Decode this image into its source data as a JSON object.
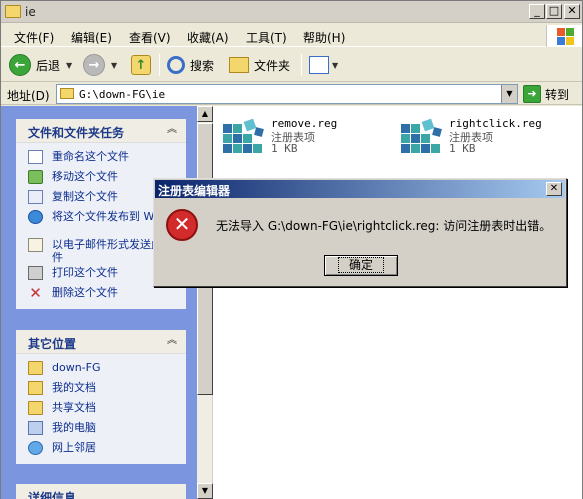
{
  "window": {
    "title": "ie"
  },
  "menu": [
    {
      "label": "文件(F)"
    },
    {
      "label": "编辑(E)"
    },
    {
      "label": "查看(V)"
    },
    {
      "label": "收藏(A)"
    },
    {
      "label": "工具(T)"
    },
    {
      "label": "帮助(H)"
    }
  ],
  "toolbar": {
    "back_label": "后退",
    "search_label": "搜索",
    "folders_label": "文件夹"
  },
  "address": {
    "label": "地址(D)",
    "value": "G:\\down-FG\\ie",
    "go_label": "转到"
  },
  "tasks": {
    "title": "文件和文件夹任务",
    "items": [
      {
        "label": "重命名这个文件",
        "icon": "rename-icon"
      },
      {
        "label": "移动这个文件",
        "icon": "move-icon"
      },
      {
        "label": "复制这个文件",
        "icon": "copy-icon"
      },
      {
        "label": "将这个文件发布到 Web",
        "icon": "publish-web-icon"
      },
      {
        "label": "以电子邮件形式发送此文件",
        "icon": "email-icon"
      },
      {
        "label": "打印这个文件",
        "icon": "print-icon"
      },
      {
        "label": "删除这个文件",
        "icon": "delete-icon"
      }
    ]
  },
  "places": {
    "title": "其它位置",
    "items": [
      {
        "label": "down-FG",
        "icon": "folder-icon"
      },
      {
        "label": "我的文档",
        "icon": "my-documents-icon"
      },
      {
        "label": "共享文档",
        "icon": "shared-documents-icon"
      },
      {
        "label": "我的电脑",
        "icon": "my-computer-icon"
      },
      {
        "label": "网上邻居",
        "icon": "network-places-icon"
      }
    ]
  },
  "details": {
    "title": "详细信息"
  },
  "files": [
    {
      "name": "remove.reg",
      "type": "注册表项",
      "size": "1 KB"
    },
    {
      "name": "rightclick.reg",
      "type": "注册表项",
      "size": "1 KB"
    }
  ],
  "dialog": {
    "title": "注册表编辑器",
    "message": "无法导入 G:\\down-FG\\ie\\rightclick.reg: 访问注册表时出错。",
    "ok_label": "确定"
  },
  "colors": {
    "taskpane_bg": "#7b96de",
    "dialog_title_start": "#0a246a",
    "error_red": "#d22b2b"
  }
}
